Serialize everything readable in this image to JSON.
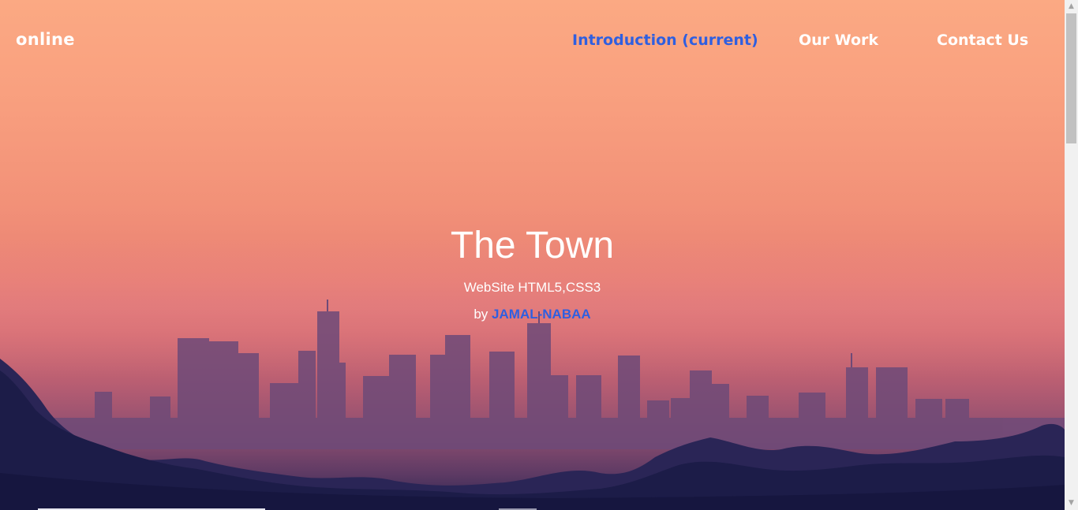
{
  "header": {
    "brand": "online",
    "nav": [
      {
        "label": "Introduction (current)",
        "active": true
      },
      {
        "label": "Our Work",
        "active": false
      },
      {
        "label": "Contact Us",
        "active": false
      }
    ]
  },
  "hero": {
    "title": "The Town",
    "subtitle": "WebSite HTML5,CSS3",
    "by_prefix": "by",
    "author": "JAMAL-NABAA"
  },
  "colors": {
    "accent": "#2f5fe0",
    "text": "#ffffff",
    "sky_top": "#fba983",
    "city": "#5a3f70",
    "hills": "#1f1f4e"
  },
  "scrollbar": {
    "up_arrow": "triangle-up-icon",
    "down_arrow": "triangle-down-icon"
  }
}
